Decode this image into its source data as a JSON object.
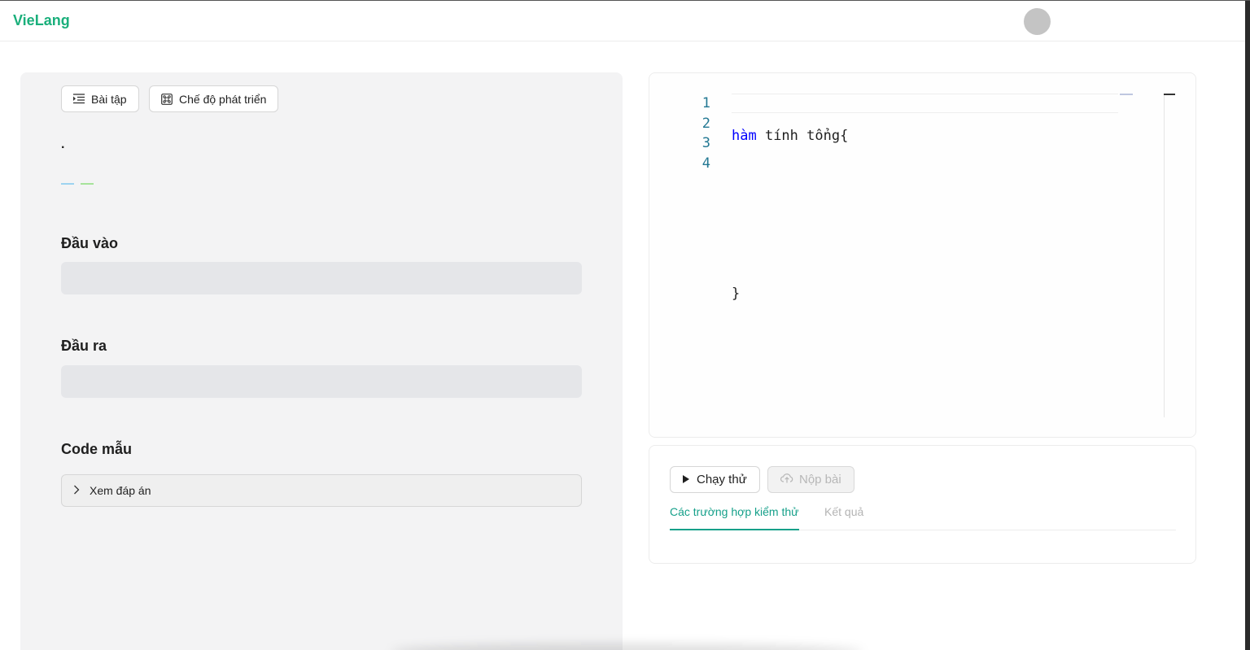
{
  "app": {
    "brand": "VieLang"
  },
  "left_panel": {
    "buttons": {
      "exercises": "Bài tập",
      "dev_mode": "Chế độ phát triển"
    },
    "dot": ".",
    "sections": {
      "input": "Đầu vào",
      "output": "Đầu ra",
      "sample_code": "Code mẫu"
    },
    "view_answer": "Xem đáp án"
  },
  "editor": {
    "line_numbers": [
      "1",
      "2",
      "3",
      "4"
    ],
    "lines": [
      {
        "keyword": "hàm",
        "rest": " tính tổng{"
      },
      {
        "text": ""
      },
      {
        "text": ""
      },
      {
        "text": "}"
      }
    ]
  },
  "run_panel": {
    "run_label": "Chạy thử",
    "submit_label": "Nộp bài",
    "tabs": [
      {
        "label": "Các trường hợp kiểm thử",
        "active": true
      },
      {
        "label": "Kết quả",
        "active": false
      }
    ]
  },
  "colors": {
    "brand": "#1aaf7b",
    "accent": "#16a08a",
    "dash_blue": "#9dd3f0",
    "dash_green": "#a6e39a"
  }
}
